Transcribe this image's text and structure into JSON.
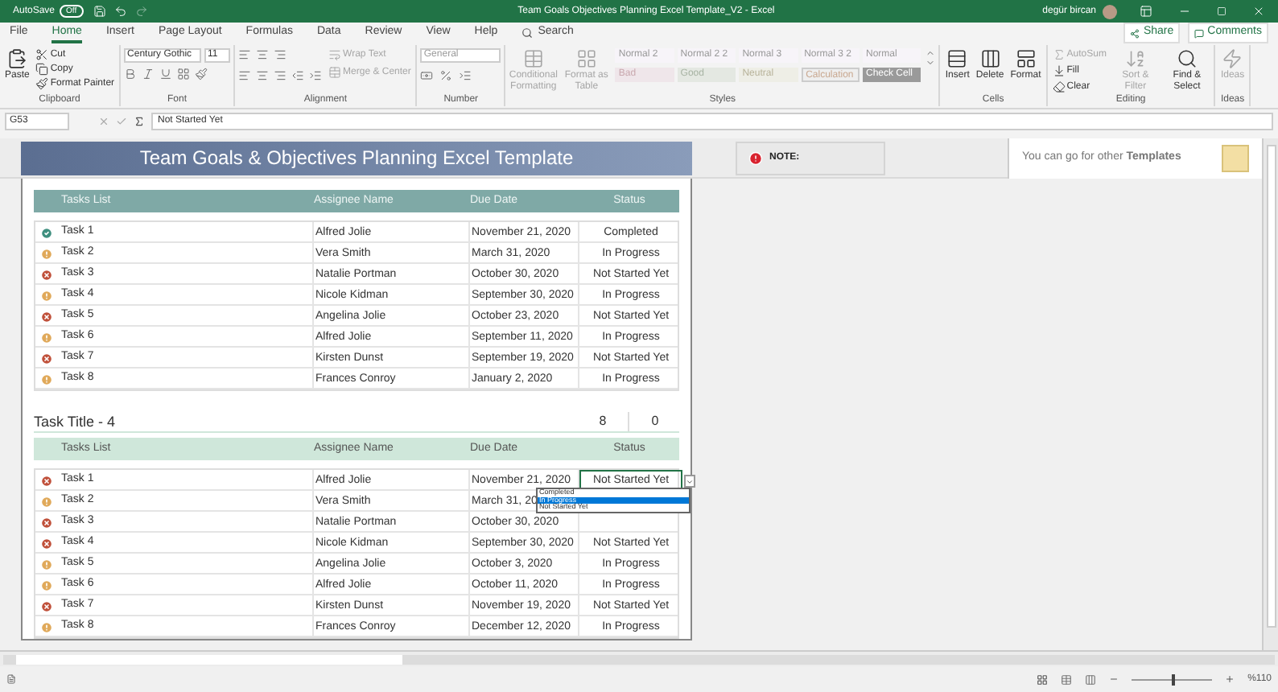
{
  "title_bar": {
    "autosave_label": "AutoSave",
    "autosave_state": "Off",
    "title": "Team Goals Objectives Planning Excel Template_V2 - Excel",
    "user": "degür bircan"
  },
  "menu_tabs": [
    {
      "label": "File",
      "selected": false
    },
    {
      "label": "Home",
      "selected": true
    },
    {
      "label": "Insert",
      "selected": false
    },
    {
      "label": "Page Layout",
      "selected": false
    },
    {
      "label": "Formulas",
      "selected": false
    },
    {
      "label": "Data",
      "selected": false
    },
    {
      "label": "Review",
      "selected": false
    },
    {
      "label": "View",
      "selected": false
    },
    {
      "label": "Help",
      "selected": false
    }
  ],
  "search": {
    "placeholder": "Search"
  },
  "share": "Share",
  "comments": "Comments",
  "ribbon": [
    {
      "kind": "clipboard",
      "label": "Clipboard",
      "buttons": [
        {
          "label": "Paste",
          "disabled": false
        },
        {
          "label": "Cut",
          "disabled": false
        },
        {
          "label": "Copy",
          "disabled": false
        },
        {
          "label": "Format Painter",
          "disabled": false
        }
      ]
    },
    {
      "kind": "font",
      "label": "Font",
      "font_name": "Century Gothic",
      "font_size": "11"
    },
    {
      "kind": "alignment",
      "label": "Alignment",
      "buttons": [
        {
          "label": "Wrap Text",
          "disabled": true
        },
        {
          "label": "Merge & Center",
          "disabled": true
        }
      ]
    },
    {
      "kind": "number",
      "label": "Number",
      "format": "General"
    },
    {
      "kind": "styles",
      "label": "Styles",
      "buttons": [
        {
          "label": "Conditional Formatting",
          "disabled": true
        },
        {
          "label": "Format as Table",
          "disabled": true
        }
      ],
      "cell_styles": [
        {
          "label": "Normal 2",
          "kind": "normal"
        },
        {
          "label": "Normal 2 2",
          "kind": "normal"
        },
        {
          "label": "Normal 3",
          "kind": "normal"
        },
        {
          "label": "Normal 3 2",
          "kind": "normal"
        },
        {
          "label": "Normal",
          "kind": "normal"
        },
        {
          "label": "Bad",
          "kind": "bad"
        },
        {
          "label": "Good",
          "kind": "good"
        },
        {
          "label": "Neutral",
          "kind": "neutral"
        },
        {
          "label": "Calculation",
          "kind": "calculation"
        },
        {
          "label": "Check Cell",
          "kind": "check"
        }
      ]
    },
    {
      "kind": "cells",
      "label": "Cells",
      "buttons": [
        {
          "label": "Insert",
          "disabled": false
        },
        {
          "label": "Delete",
          "disabled": false
        },
        {
          "label": "Format",
          "disabled": false
        }
      ]
    },
    {
      "kind": "editing",
      "label": "Editing",
      "buttons": [
        {
          "label": "AutoSum",
          "disabled": true
        },
        {
          "label": "Fill",
          "disabled": false
        },
        {
          "label": "Clear",
          "disabled": false
        },
        {
          "label": "Sort & Filter",
          "disabled": true
        },
        {
          "label": "Find & Select",
          "disabled": false
        }
      ]
    },
    {
      "kind": "ideas",
      "label": "Ideas",
      "buttons": [
        {
          "label": "Ideas",
          "disabled": true
        }
      ]
    }
  ],
  "formula_bar": {
    "cell": "G53",
    "value": "Not Started Yet"
  },
  "banner": {
    "title": "Team Goals & Objectives Planning Excel Template"
  },
  "note": {
    "label": "NOTE:"
  },
  "promo": {
    "text": "You can go for other **Templates**"
  },
  "tables": [
    {
      "color": "#7fa9a6",
      "columns": [
        "Tasks List",
        "Assignee Name",
        "Due Date",
        "Status"
      ],
      "rows": [
        {
          "task": "Task 1",
          "assignee": "Alfred Jolie",
          "due": "November 21, 2020",
          "status": "Completed",
          "kind": "completed",
          "active": false
        },
        {
          "task": "Task 2",
          "assignee": "Vera Smith",
          "due": "March 31, 2020",
          "status": "In Progress",
          "kind": "in_progress",
          "active": false
        },
        {
          "task": "Task 3",
          "assignee": "Natalie Portman",
          "due": "October 30, 2020",
          "status": "Not Started Yet",
          "kind": "not_started",
          "active": false
        },
        {
          "task": "Task 4",
          "assignee": "Nicole Kidman",
          "due": "September 30, 2020",
          "status": "In Progress",
          "kind": "in_progress",
          "active": false
        },
        {
          "task": "Task 5",
          "assignee": "Angelina Jolie",
          "due": "October 23, 2020",
          "status": "Not Started Yet",
          "kind": "not_started",
          "active": false
        },
        {
          "task": "Task 6",
          "assignee": "Alfred Jolie",
          "due": "September 11, 2020",
          "status": "In Progress",
          "kind": "in_progress",
          "active": false
        },
        {
          "task": "Task 7",
          "assignee": "Kirsten Dunst",
          "due": "September 19, 2020",
          "status": "Not Started Yet",
          "kind": "not_started",
          "active": false
        },
        {
          "task": "Task 8",
          "assignee": "Frances Conroy",
          "due": "January 2, 2020",
          "status": "In Progress",
          "kind": "in_progress",
          "active": false
        }
      ]
    },
    {
      "title": "Task Title - 4",
      "counts": [
        "8",
        "0"
      ],
      "color": "#cfe7da",
      "columns": [
        "Tasks List",
        "Assignee Name",
        "Due Date",
        "Status"
      ],
      "rows": [
        {
          "task": "Task 1",
          "assignee": "Alfred Jolie",
          "due": "November 21, 2020",
          "status": "Not Started Yet",
          "kind": "not_started",
          "active": true
        },
        {
          "task": "Task 2",
          "assignee": "Vera Smith",
          "due": "March 31, 20",
          "kind": "in_progress",
          "active": false
        },
        {
          "task": "Task 3",
          "assignee": "Natalie Portman",
          "due": "October 30, 2020",
          "kind": "not_started",
          "active": false
        },
        {
          "task": "Task 4",
          "assignee": "Nicole Kidman",
          "due": "September 30, 2020",
          "status": "Not Started Yet",
          "kind": "not_started",
          "active": false
        },
        {
          "task": "Task 5",
          "assignee": "Angelina Jolie",
          "due": "October 3, 2020",
          "status": "In Progress",
          "kind": "in_progress",
          "active": false
        },
        {
          "task": "Task 6",
          "assignee": "Alfred Jolie",
          "due": "October 11, 2020",
          "status": "In Progress",
          "kind": "in_progress",
          "active": false
        },
        {
          "task": "Task 7",
          "assignee": "Kirsten Dunst",
          "due": "November 19, 2020",
          "status": "Not Started Yet",
          "kind": "not_started",
          "active": false
        },
        {
          "task": "Task 8",
          "assignee": "Frances Conroy",
          "due": "December 12, 2020",
          "status": "In Progress",
          "kind": "in_progress",
          "active": false
        }
      ],
      "dropdown": {
        "options": [
          {
            "label": "Completed",
            "selected": false
          },
          {
            "label": "In Progress",
            "selected": true
          },
          {
            "label": "Not Started Yet",
            "selected": false
          }
        ]
      }
    }
  ],
  "status_bar": {
    "zoom": "%110",
    "zoom_slider": {
      "level": 0.5
    }
  }
}
